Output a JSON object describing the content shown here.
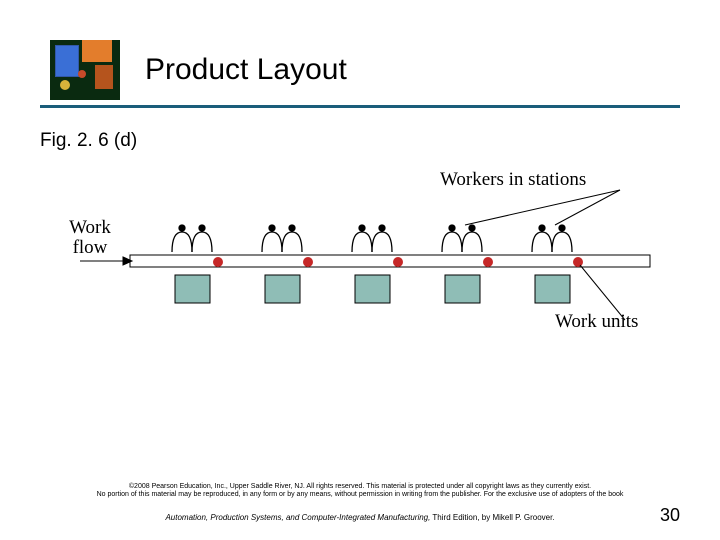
{
  "header": {
    "title": "Product Layout"
  },
  "fig_label": "Fig. 2. 6 (d)",
  "labels": {
    "workers": "Workers in stations",
    "workflow_line1": "Work",
    "workflow_line2": "flow",
    "workunits": "Work units"
  },
  "footer": {
    "copyright_line1": "©2008 Pearson Education, Inc., Upper Saddle River, NJ.  All rights reserved.  This material is protected under all copyright laws as they currently exist.",
    "copyright_line2": "No portion of this material may be reproduced, in any form or by any means, without permission in writing from the publisher.  For the exclusive use of adopters of the book",
    "book_title": "Automation, Production Systems, and Computer-Integrated Manufacturing,",
    "book_rest": " Third Edition, by Mikell P. Groover."
  },
  "page_number": "30",
  "chart_data": {
    "type": "diagram",
    "description": "Product layout: linear conveyor with work units and workers at stations",
    "stations": 5,
    "work_units_on_boxes": 5,
    "work_units_on_conveyor": 5,
    "annotations": [
      "Workers in stations",
      "Work flow",
      "Work units"
    ]
  }
}
